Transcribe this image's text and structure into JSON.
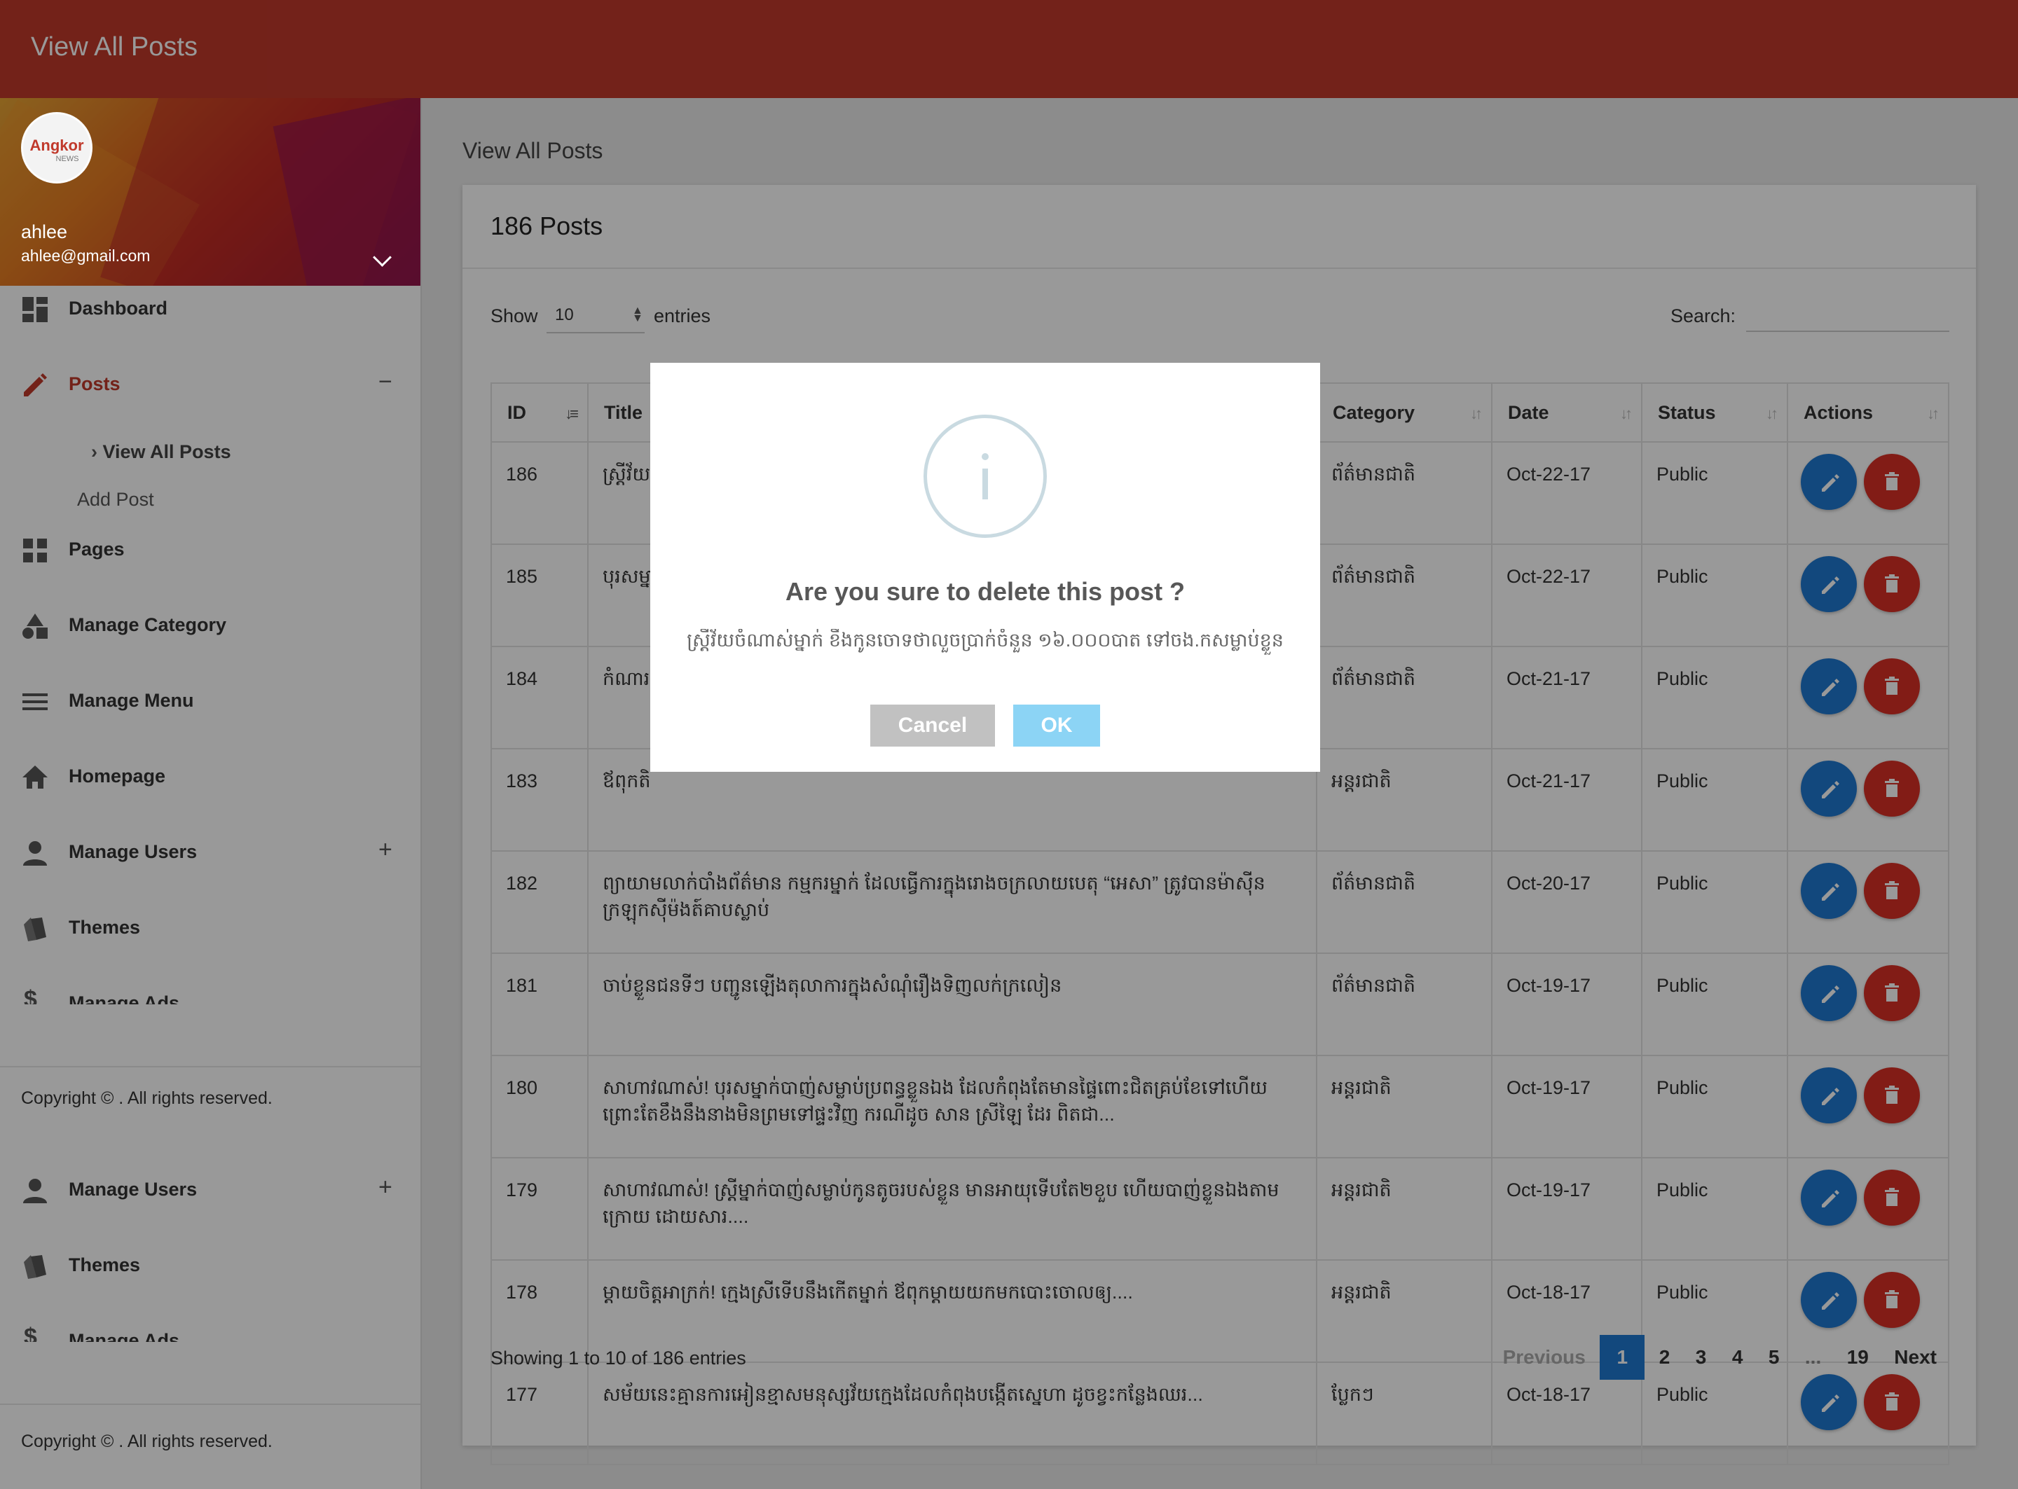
{
  "header": {
    "title": "View All Posts"
  },
  "profile": {
    "logo_line1": "Angkor",
    "logo_line2": "NEWS",
    "name": "ahlee",
    "email": "ahlee@gmail.com"
  },
  "sidebar": {
    "items": [
      {
        "label": "Dashboard",
        "icon": "dashboard-icon"
      },
      {
        "label": "Posts",
        "icon": "pencil-icon",
        "toggle": "−"
      },
      {
        "label": "Pages",
        "icon": "pages-icon"
      },
      {
        "label": "Manage Category",
        "icon": "category-icon"
      },
      {
        "label": "Manage Menu",
        "icon": "menu-icon"
      },
      {
        "label": "Homepage",
        "icon": "home-icon"
      },
      {
        "label": "Manage Users",
        "icon": "user-icon",
        "toggle": "+"
      },
      {
        "label": "Themes",
        "icon": "themes-icon"
      },
      {
        "label": "Manage Ads",
        "icon": "dollar-icon"
      }
    ],
    "posts_sub": {
      "view_all": "View All Posts",
      "add": "Add Post"
    },
    "copyright": "Copyright © . All rights reserved.",
    "repeat_items": [
      {
        "label": "Manage Users",
        "icon": "user-icon",
        "toggle": "+"
      },
      {
        "label": "Themes",
        "icon": "themes-icon"
      },
      {
        "label": "Manage Ads",
        "icon": "dollar-icon"
      }
    ]
  },
  "main": {
    "breadcrumb": "View All Posts",
    "card_title": "186 Posts",
    "show_label": "Show",
    "show_value": "10",
    "entries_label": "entries",
    "search_label": "Search:",
    "search_value": "",
    "columns": [
      "ID",
      "Title",
      "Category",
      "Date",
      "Status",
      "Actions"
    ],
    "rows": [
      {
        "id": "186",
        "title": "ស្ត្រីវ័យ",
        "category": "ព័ត៌មានជាតិ",
        "date": "Oct-22-17",
        "status": "Public"
      },
      {
        "id": "185",
        "title": "បុរសម្នា",
        "category": "ព័ត៌មានជាតិ",
        "date": "Oct-22-17",
        "status": "Public"
      },
      {
        "id": "184",
        "title": "កំណារ ពិតពេ",
        "category": "ព័ត៌មានជាតិ",
        "date": "Oct-21-17",
        "status": "Public"
      },
      {
        "id": "183",
        "title": "ឪពុកតិ",
        "category": "អន្តរជាតិ",
        "date": "Oct-21-17",
        "status": "Public"
      },
      {
        "id": "182",
        "title": "ព្យាយាមលាក់បាំងព័ត៌មាន កម្មករម្នាក់ ដែលធ្វើការក្នុងរោងចក្រលាយបេតុ “អេសា” ត្រូវបានម៉ាស៊ីនក្រឡុកស៊ីម៉ងត៍គាបស្លាប់",
        "category": "ព័ត៌មានជាតិ",
        "date": "Oct-20-17",
        "status": "Public"
      },
      {
        "id": "181",
        "title": "ចាប់ខ្លួនជនទីៗ បញ្ជូនឡើងតុលាការក្នុងសំណុំរឿងទិញលក់ក្រលៀន",
        "category": "ព័ត៌មានជាតិ",
        "date": "Oct-19-17",
        "status": "Public"
      },
      {
        "id": "180",
        "title": "សាហាវណាស់! បុរសម្នាក់បាញ់សម្លាប់ប្រពន្ធខ្លួនឯង ដែលកំពុងតែមានផ្ទៃពោះជិតគ្រប់ខែទៅហើយ ព្រោះតែខឹងនឹងនាងមិនព្រមទៅផ្ទះវិញ ករណីដូច សាន ស្រីឡៃ ដែរ ពិតជា...",
        "category": "អន្តរជាតិ",
        "date": "Oct-19-17",
        "status": "Public"
      },
      {
        "id": "179",
        "title": "សាហាវណាស់! ស្ត្រីម្នាក់បាញ់សម្លាប់កូនតូចរបស់ខ្លួន មានអាយុទើបតែ២ខួប ហើយបាញ់ខ្លួនឯងតាមក្រោយ ដោយសារ....",
        "category": "អន្តរជាតិ",
        "date": "Oct-19-17",
        "status": "Public"
      },
      {
        "id": "178",
        "title": "ម្ដាយចិត្តអាក្រក់! ក្មេងស្រីទើបនឹងកើតម្នាក់ ឪពុកម្ដាយយកមកបោះចោលឲ្យ....",
        "category": "អន្តរជាតិ",
        "date": "Oct-18-17",
        "status": "Public"
      },
      {
        "id": "177",
        "title": "សម័យនេះគ្មានការអៀនខ្មាសមនុស្សវ័យក្មេងដែលកំពុងបង្កើតស្នេហា ដូចខ្វះកន្លែងឈរ...",
        "category": "ប្លែកៗ",
        "date": "Oct-18-17",
        "status": "Public"
      }
    ],
    "showing": "Showing 1 to 10 of 186 entries",
    "pagination": {
      "previous": "Previous",
      "pages": [
        "1",
        "2",
        "3",
        "4",
        "5"
      ],
      "ellipsis": "...",
      "last": "19",
      "next": "Next",
      "current": "1"
    }
  },
  "modal": {
    "icon": "info-icon",
    "question": "Are you sure to delete this post ?",
    "message": "ស្ត្រីវ័យចំណាស់ម្នាក់ ខឹងកូនចោទថាលួចប្រាក់ចំនួន ១៦.០០០បាត ទៅចង.កសម្លាប់ខ្លួន",
    "cancel": "Cancel",
    "ok": "OK"
  },
  "colors": {
    "header": "#c0392b",
    "primary": "#1f78d1",
    "danger": "#d93025",
    "ok": "#8cd4f5",
    "cancel": "#c1c1c1"
  }
}
